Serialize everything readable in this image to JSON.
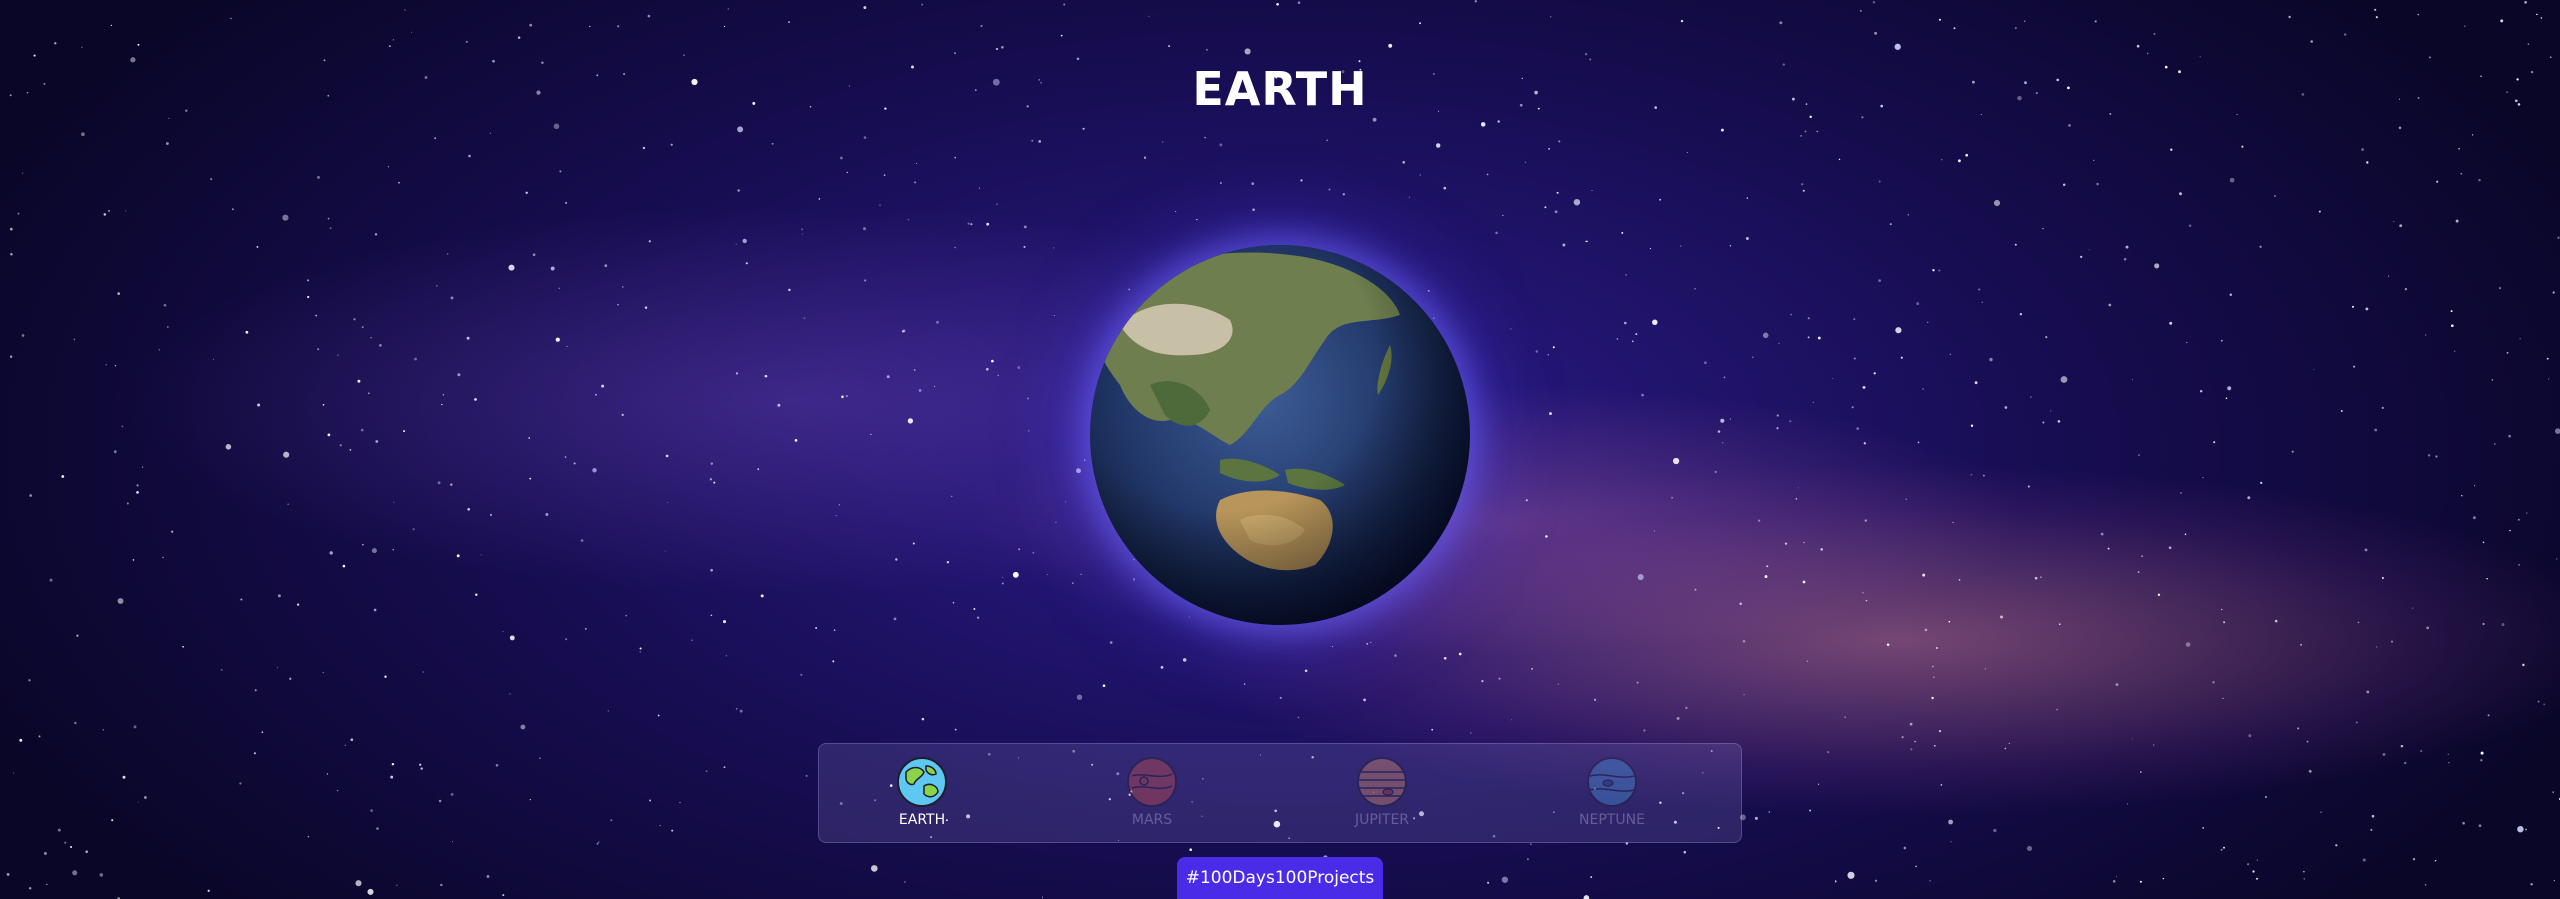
{
  "page": {
    "title": "EARTH"
  },
  "planet": {
    "name": "earth"
  },
  "nav": {
    "items": [
      {
        "label": "EARTH",
        "icon": "earth-icon",
        "active": true
      },
      {
        "label": "MARS",
        "icon": "mars-icon",
        "active": false
      },
      {
        "label": "JUPITER",
        "icon": "jupiter-icon",
        "active": false
      },
      {
        "label": "NEPTUNE",
        "icon": "neptune-icon",
        "active": false
      }
    ]
  },
  "badge": {
    "label": "#100Days100Projects"
  },
  "colors": {
    "badge_bg": "#4a2be8",
    "glow": "#6e64ff",
    "space_deep": "#0a0628"
  }
}
